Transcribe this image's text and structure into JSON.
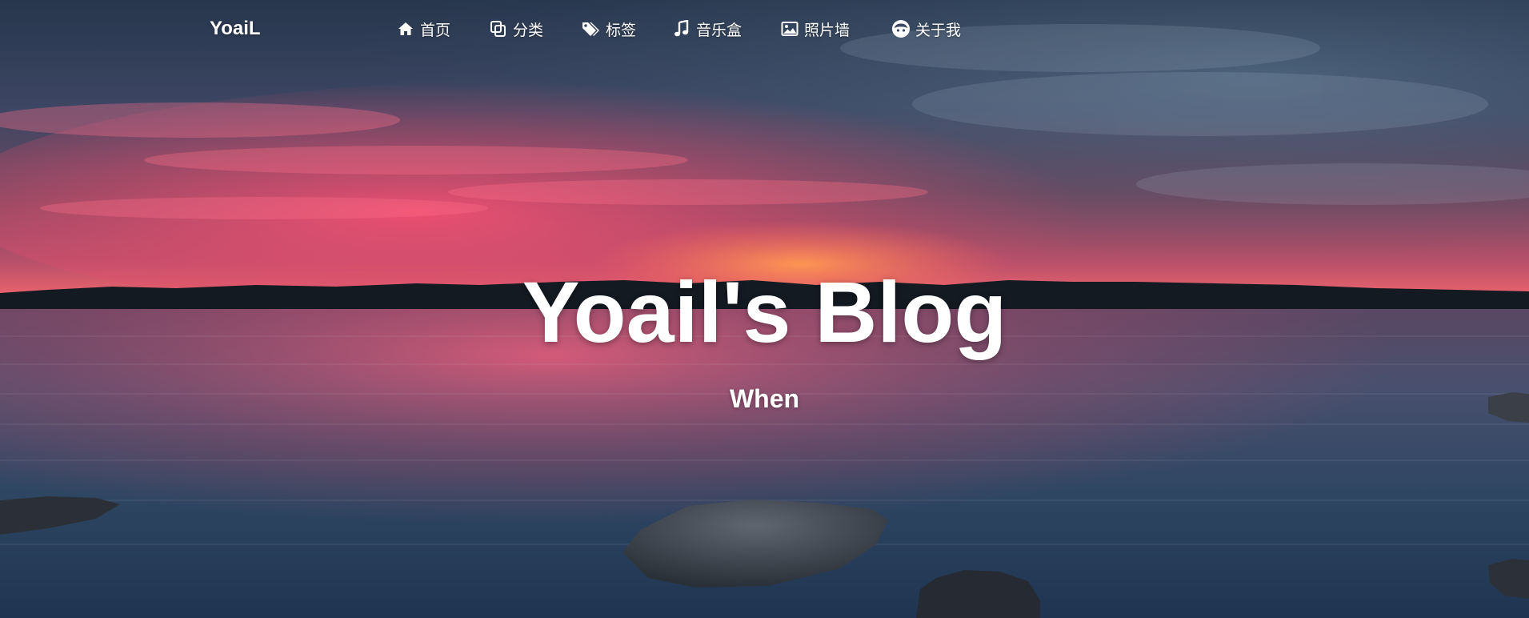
{
  "brand": {
    "name": "YoaiL"
  },
  "nav": {
    "items": [
      {
        "label": "首页",
        "icon": "home-icon"
      },
      {
        "label": "分类",
        "icon": "copy-icon"
      },
      {
        "label": "标签",
        "icon": "tags-icon"
      },
      {
        "label": "音乐盒",
        "icon": "music-note-icon"
      },
      {
        "label": "照片墙",
        "icon": "image-icon"
      },
      {
        "label": "关于我",
        "icon": "smiley-face-icon"
      }
    ]
  },
  "hero": {
    "title": "Yoail's Blog",
    "subtitle": "When"
  },
  "colors": {
    "text": "#ffffff",
    "sky_top": "#2b3d57",
    "sunset_pink": "#ff5a78",
    "sunset_orange": "#ff8c5a",
    "water": "#2a4663",
    "treeline": "#141a22"
  }
}
